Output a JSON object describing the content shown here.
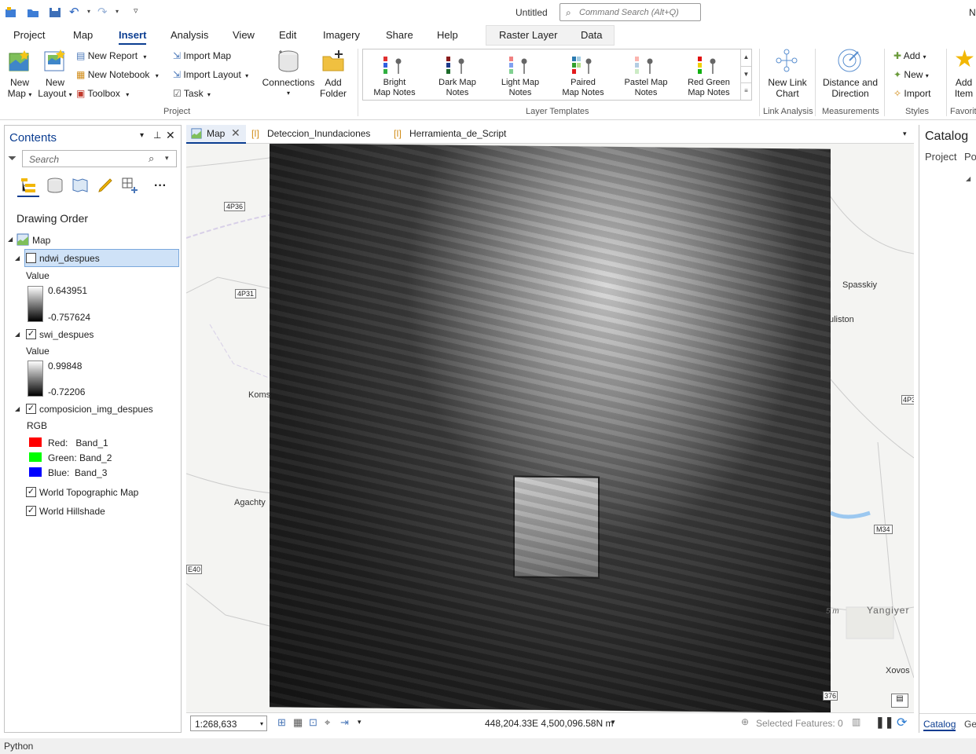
{
  "window": {
    "title": "Untitled",
    "corner_text": "N"
  },
  "search": {
    "placeholder": "Command Search (Alt+Q)"
  },
  "tabs": [
    "Project",
    "Map",
    "Insert",
    "Analysis",
    "View",
    "Edit",
    "Imagery",
    "Share",
    "Help"
  ],
  "context_tabs": [
    "Raster Layer",
    "Data"
  ],
  "ribbon": {
    "new_map": [
      "New",
      "Map"
    ],
    "new_layout": [
      "New",
      "Layout"
    ],
    "new_report": "New Report",
    "new_notebook": "New Notebook",
    "toolbox": "Toolbox",
    "import_map": "Import Map",
    "import_layout": "Import Layout",
    "task": "Task",
    "connections": "Connections",
    "add_folder": [
      "Add",
      "Folder"
    ],
    "project_group": "Project",
    "templates": [
      {
        "l1": "Bright",
        "l2": "Map Notes"
      },
      {
        "l1": "Dark Map",
        "l2": "Notes"
      },
      {
        "l1": "Light Map",
        "l2": "Notes"
      },
      {
        "l1": "Paired",
        "l2": "Map Notes"
      },
      {
        "l1": "Pastel Map",
        "l2": "Notes"
      },
      {
        "l1": "Red Green",
        "l2": "Map Notes"
      }
    ],
    "templates_group": "Layer Templates",
    "new_link_chart": [
      "New Link",
      "Chart"
    ],
    "link_analysis_group": "Link Analysis",
    "distance": [
      "Distance and",
      "Direction"
    ],
    "measurements_group": "Measurements",
    "styles_add": "Add",
    "styles_new": "New",
    "styles_import": "Import",
    "styles_group": "Styles",
    "add_item": [
      "Add",
      "Item"
    ],
    "favorites_group": "Favorit"
  },
  "contents": {
    "title": "Contents",
    "search_placeholder": "Search",
    "drawing_order": "Drawing Order",
    "map_label": "Map",
    "layers": {
      "ndwi": {
        "name": "ndwi_despues",
        "value_label": "Value",
        "max": "0.643951",
        "min": "-0.757624"
      },
      "swi": {
        "name": "swi_despues",
        "value_label": "Value",
        "max": "0.99848",
        "min": "-0.72206"
      },
      "comp": {
        "name": "composicion_img_despues",
        "rgb_label": "RGB",
        "red": "Red:   Band_1",
        "green": "Green: Band_2",
        "blue": "Blue:  Band_3"
      },
      "topo": "World Topographic Map",
      "hillshade": "World Hillshade"
    }
  },
  "view_tabs": [
    "Map",
    "Deteccion_Inundaciones",
    "Herramienta_de_Script"
  ],
  "map_labels": {
    "r1": "4P36",
    "r2": "4P31",
    "r3": "E40",
    "r4": "4P3",
    "r5": "M34",
    "r6": "376",
    "spasskiy": "Spasskiy",
    "guliston": "uliston",
    "koms": "Koms",
    "agachty": "Agachty",
    "yangiyer": "Yangiyer",
    "xovos": "Xovos",
    "m": "5 m"
  },
  "status": {
    "scale": "1:268,633",
    "coords": "448,204.33E 4,500,096.58N m",
    "selected": "Selected Features: 0"
  },
  "catalog": {
    "title": "Catalog",
    "tab1": "Project",
    "tab2": "Po",
    "bottom1": "Catalog",
    "bottom2": "Ge"
  },
  "bottom": {
    "python": "Python"
  },
  "colors": {
    "accent": "#0b3d91",
    "red": "#ff0000",
    "green": "#00ff00",
    "blue": "#0000ff"
  }
}
